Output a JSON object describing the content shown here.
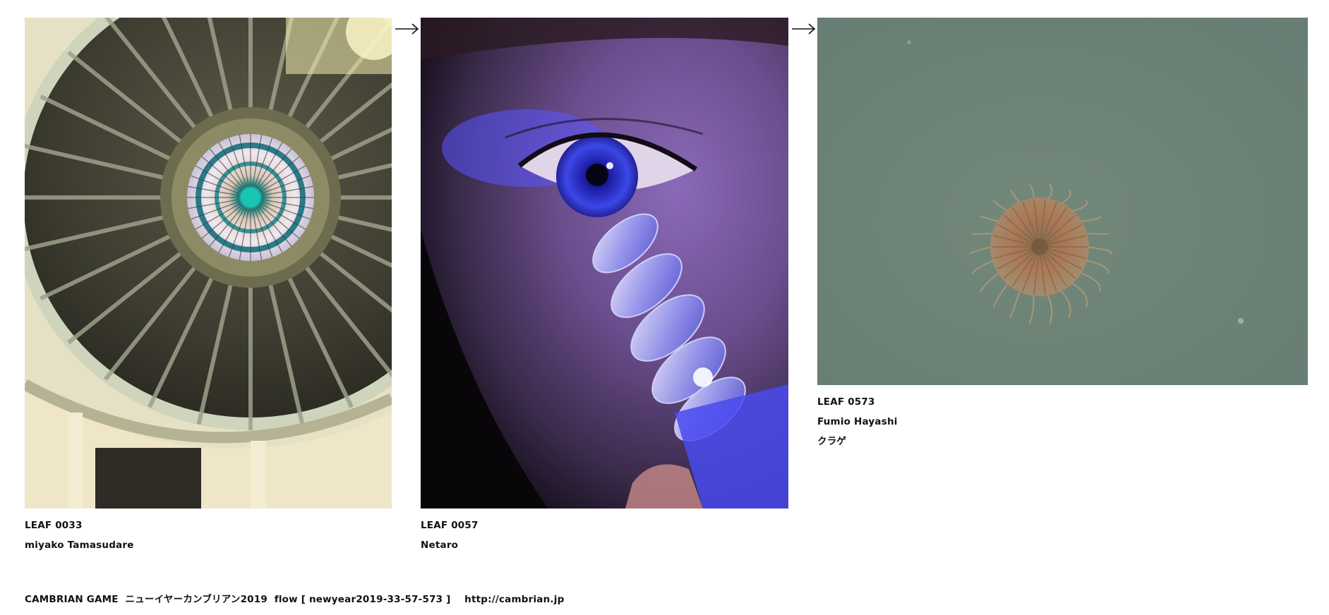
{
  "leaves": [
    {
      "id": "LEAF 0033",
      "author": "miyako Tamasudare",
      "title": "",
      "image": "dome-ceiling-photo"
    },
    {
      "id": "LEAF 0057",
      "author": "Netaro",
      "title": "",
      "image": "blue-lit-eye-photo"
    },
    {
      "id": "LEAF 0573",
      "author": "Fumio Hayashi",
      "title": "クラゲ",
      "image": "jellyfish-photo"
    }
  ],
  "arrow_glyph": "arrow-right-icon",
  "footer": {
    "text": "CAMBRIAN GAME  ニューイヤーカンブリアン2019  flow [ newyear2019-33-57-573 ]    http://cambrian.jp"
  }
}
